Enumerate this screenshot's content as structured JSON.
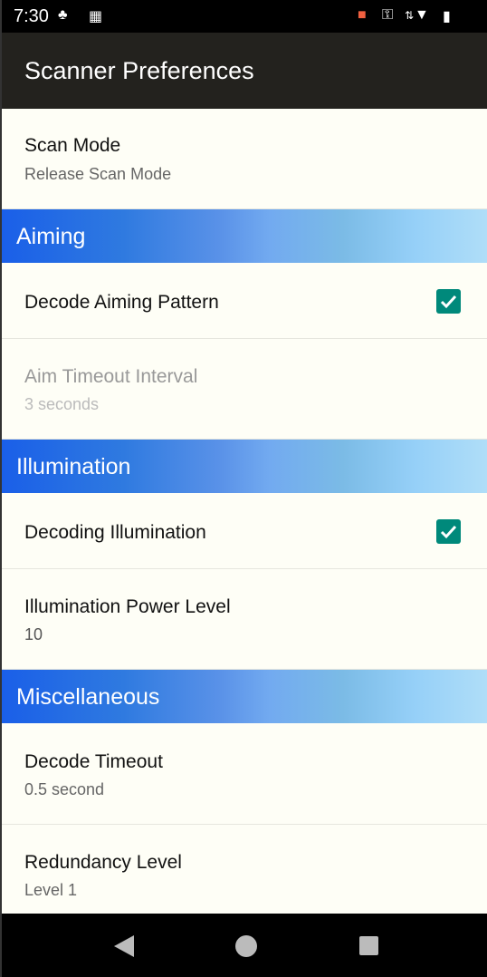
{
  "status_bar": {
    "time": "7:30",
    "icons": [
      "assistant-icon",
      "apps-grid-icon",
      "cast-icon",
      "vpn-key-icon",
      "data-arrows-icon",
      "wifi-icon",
      "battery-icon"
    ]
  },
  "header": {
    "title": "Scanner Preferences"
  },
  "items": {
    "scan_mode": {
      "title": "Scan Mode",
      "summary": "Release Scan Mode"
    },
    "aiming_header": "Aiming",
    "decode_aiming": {
      "title": "Decode Aiming Pattern",
      "checked": true
    },
    "aim_timeout": {
      "title": "Aim Timeout Interval",
      "summary": "3 seconds",
      "enabled": false
    },
    "illumination_header": "Illumination",
    "decoding_illumination": {
      "title": "Decoding Illumination",
      "checked": true
    },
    "illumination_power": {
      "title": "Illumination Power Level",
      "summary": "10"
    },
    "misc_header": "Miscellaneous",
    "decode_timeout": {
      "title": "Decode Timeout",
      "summary": "0.5 second"
    },
    "redundancy": {
      "title": "Redundancy Level",
      "summary": "Level 1"
    }
  },
  "colors": {
    "checkbox": "#00897b",
    "header": "#23221e",
    "section_start": "#1a5fe8",
    "section_end": "#b0def8"
  }
}
